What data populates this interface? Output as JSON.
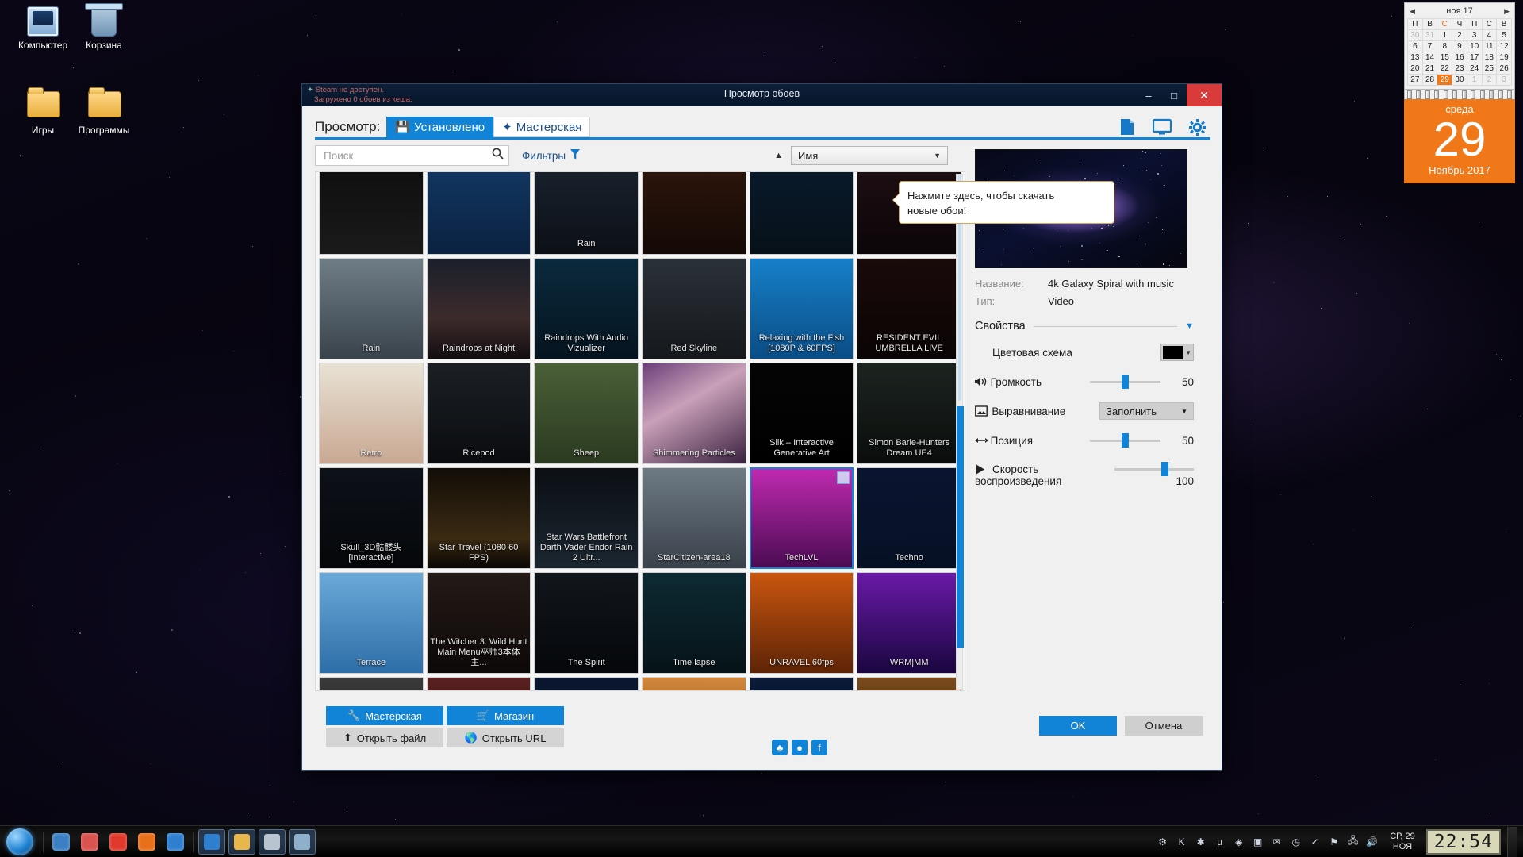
{
  "desktop": {
    "icons": [
      {
        "label": "Компьютер",
        "icon": "computer-icon"
      },
      {
        "label": "Корзина",
        "icon": "recycle-bin-icon"
      },
      {
        "label": "Игры",
        "icon": "folder-icon"
      },
      {
        "label": "Программы",
        "icon": "folder-icon"
      }
    ]
  },
  "calendar": {
    "month_label": "ноя 17",
    "prev_icon": "chevron-left-icon",
    "next_icon": "chevron-right-icon",
    "weekdays": [
      "П",
      "В",
      "С",
      "Ч",
      "П",
      "С",
      "В"
    ],
    "weeks": [
      [
        {
          "d": "30",
          "dim": true
        },
        {
          "d": "31",
          "dim": true
        },
        {
          "d": "1"
        },
        {
          "d": "2"
        },
        {
          "d": "3"
        },
        {
          "d": "4"
        },
        {
          "d": "5"
        }
      ],
      [
        {
          "d": "6"
        },
        {
          "d": "7"
        },
        {
          "d": "8"
        },
        {
          "d": "9"
        },
        {
          "d": "10"
        },
        {
          "d": "11"
        },
        {
          "d": "12"
        }
      ],
      [
        {
          "d": "13"
        },
        {
          "d": "14"
        },
        {
          "d": "15"
        },
        {
          "d": "16"
        },
        {
          "d": "17"
        },
        {
          "d": "18"
        },
        {
          "d": "19"
        }
      ],
      [
        {
          "d": "20"
        },
        {
          "d": "21"
        },
        {
          "d": "22"
        },
        {
          "d": "23"
        },
        {
          "d": "24"
        },
        {
          "d": "25"
        },
        {
          "d": "26"
        }
      ],
      [
        {
          "d": "27"
        },
        {
          "d": "28"
        },
        {
          "d": "29",
          "today": true
        },
        {
          "d": "30"
        },
        {
          "d": "1",
          "dim": true
        },
        {
          "d": "2",
          "dim": true
        },
        {
          "d": "3",
          "dim": true
        }
      ]
    ],
    "dow": "среда",
    "day": "29",
    "month_year": "Ноябрь 2017",
    "accent": "#f07818"
  },
  "window": {
    "title": "Просмотр обоев",
    "minimize_icon": "minimize-icon",
    "maximize_icon": "maximize-icon",
    "close_icon": "close-icon",
    "warnings": {
      "line1": "Steam не доступен.",
      "line2": "Загружено 0 обоев из кеша."
    },
    "header": {
      "view_label": "Просмотр:",
      "tabs": [
        {
          "label": "Установлено",
          "icon": "save-disk-icon",
          "active": true
        },
        {
          "label": "Мастерская",
          "icon": "steam-icon",
          "active": false
        }
      ],
      "icons": [
        {
          "name": "file-icon"
        },
        {
          "name": "monitor-icon"
        },
        {
          "name": "gear-icon"
        }
      ]
    },
    "tooltip": {
      "line1": "Нажмите здесь, чтобы скачать",
      "line2": "новые обои!"
    },
    "toolbar": {
      "search_placeholder": "Поиск",
      "search_value": "",
      "search_icon": "search-icon",
      "filters_label": "Фильтры",
      "filter_icon": "funnel-icon",
      "sort_direction_icon": "sort-ascending-icon",
      "sort_value": "Имя",
      "sort_caret_icon": "chevron-down-icon"
    },
    "grid": {
      "rows": [
        [
          {
            "caption": "",
            "cut": true,
            "bg": "linear-gradient(180deg,#0d0d0d,#1a1a1a)"
          },
          {
            "caption": "",
            "cut": true,
            "bg": "linear-gradient(180deg,#123a66,#0b2140)"
          },
          {
            "caption": "Rain",
            "cut": true,
            "bg": "linear-gradient(180deg,#1a2330,#0c1016)"
          },
          {
            "caption": "",
            "cut": true,
            "bg": "linear-gradient(180deg,#30170d,#140905)"
          },
          {
            "caption": "",
            "cut": true,
            "bg": "linear-gradient(180deg,#0a1b2e,#061018)"
          },
          {
            "caption": "",
            "cut": true,
            "bg": "linear-gradient(180deg,#201014,#0b0508)"
          }
        ],
        [
          {
            "caption": "Rain",
            "bg": "linear-gradient(180deg,#6f7d86,#39434c)"
          },
          {
            "caption": "Raindrops at Night",
            "bg": "linear-gradient(180deg,#1a1f2b,#3d2b2b 60%,#120d10)"
          },
          {
            "caption": "Raindrops With Audio Vizualizer",
            "bg": "linear-gradient(180deg,#0b2a3d,#05141f)"
          },
          {
            "caption": "Red Skyline",
            "bg": "linear-gradient(180deg,#2a3138,#15181c)"
          },
          {
            "caption": "Relaxing with the Fish [1080P & 60FPS]",
            "bg": "linear-gradient(180deg,#1680c8,#0a4d86)"
          },
          {
            "caption": "RESIDENT EVIL UMBRELLA LIVE",
            "bg": "linear-gradient(180deg,#1a0a0a,#0a0404)"
          }
        ],
        [
          {
            "caption": "Retro",
            "bg": "linear-gradient(180deg,#e8e2d4,#c9a893)"
          },
          {
            "caption": "Ricepod",
            "bg": "linear-gradient(180deg,#1b1f24,#0a0c0f)"
          },
          {
            "caption": "Sheep",
            "bg": "linear-gradient(180deg,#4a6038,#2b3a20)"
          },
          {
            "caption": "Shimmering Particles",
            "bg": "linear-gradient(150deg,#6b3f7a,#c9a0b8 40%,#3a2140)"
          },
          {
            "caption": "Silk – Interactive Generative Art",
            "bg": "linear-gradient(180deg,#050505,#000)"
          },
          {
            "caption": "Simon Barle-Hunters Dream UE4",
            "bg": "linear-gradient(180deg,#1c2420,#0a0d0b)"
          }
        ],
        [
          {
            "caption": "Skull_3D骷髅头[Interactive]",
            "bg": "linear-gradient(180deg,#0d1118,#05070a)"
          },
          {
            "caption": "Star Travel (1080 60 FPS)",
            "bg": "linear-gradient(180deg,#120d07,#3a2a12 70%,#0a0704)"
          },
          {
            "caption": "Star Wars Battlefront Darth Vader Endor Rain 2 Ultr...",
            "bg": "linear-gradient(180deg,#0b0f14,#1b2630)"
          },
          {
            "caption": "StarCitizen-area18",
            "bg": "linear-gradient(180deg,#6e7a84,#39414a)"
          },
          {
            "caption": "TechLVL",
            "selected": true,
            "bg": "linear-gradient(180deg,#c02ab0,#4a0b52)"
          },
          {
            "caption": "Techno",
            "bg": "linear-gradient(180deg,#0a1430,#061024)"
          }
        ],
        [
          {
            "caption": "Terrace",
            "bg": "linear-gradient(180deg,#6aa9d8,#2e6ea8)"
          },
          {
            "caption": "The Witcher 3: Wild Hunt Main Menu巫师3本体主...",
            "bg": "linear-gradient(180deg,#241a16,#0d0908)"
          },
          {
            "caption": "The Spirit",
            "bg": "linear-gradient(180deg,#11161c,#05070a)"
          },
          {
            "caption": "Time lapse",
            "bg": "linear-gradient(180deg,#0d2a33,#061318)"
          },
          {
            "caption": "UNRAVEL 60fps",
            "bg": "linear-gradient(180deg,#c9560f,#5e2406)"
          },
          {
            "caption": "WRM|MM",
            "bg": "linear-gradient(180deg,#6a1aa8,#1a0640)"
          }
        ],
        [
          {
            "caption": "",
            "cut": true,
            "bg": "linear-gradient(180deg,#3a3a3a,#101010)"
          },
          {
            "caption": "",
            "cut": true,
            "bg": "linear-gradient(180deg,#5a2020,#200808)"
          },
          {
            "caption": "",
            "cut": true,
            "bg": "linear-gradient(180deg,#0a1730,#04080f)"
          },
          {
            "caption": "",
            "cut": true,
            "bg": "linear-gradient(180deg,#d2883c,#6b3d14)"
          },
          {
            "caption": "",
            "cut": true,
            "bg": "linear-gradient(180deg,#0a1a38,#030812)"
          },
          {
            "caption": "",
            "cut": true,
            "bg": "linear-gradient(180deg,#7a4a1a,#2a1608)"
          }
        ]
      ]
    },
    "details": {
      "name_key": "Название:",
      "name_value": "4k Galaxy Spiral with music",
      "type_key": "Тип:",
      "type_value": "Video",
      "properties_label": "Свойства",
      "properties_caret_icon": "chevron-down-icon",
      "color_scheme_label": "Цветовая схема",
      "color_scheme_value": "#000000",
      "volume_label": "Громкость",
      "volume_icon": "speaker-icon",
      "volume_value": "50",
      "volume_percent": 50,
      "alignment_label": "Выравнивание",
      "alignment_icon": "image-icon",
      "alignment_value": "Заполнить",
      "position_label": "Позиция",
      "position_icon": "arrows-horizontal-icon",
      "position_value": "50",
      "position_percent": 50,
      "speed_label": "Скорость",
      "speed_label2": "воспроизведения",
      "speed_icon": "play-icon",
      "speed_value": "100",
      "speed_percent": 66
    },
    "footer": {
      "workshop_label": "Мастерская",
      "workshop_icon": "wrench-icon",
      "store_label": "Магазин",
      "store_icon": "cart-icon",
      "open_file_label": "Открыть файл",
      "open_file_icon": "upload-icon",
      "open_url_label": "Открыть URL",
      "open_url_icon": "globe-icon",
      "social": [
        {
          "name": "steam-icon",
          "glyph": "♨"
        },
        {
          "name": "twitter-icon",
          "glyph": "🐦"
        },
        {
          "name": "facebook-icon",
          "glyph": "f"
        }
      ],
      "ok_label": "OK",
      "cancel_label": "Отмена"
    }
  },
  "taskbar": {
    "start_icon": "windows-start-icon",
    "pinned": [
      {
        "name": "explorer-taskbar-icon",
        "glyph": "🗂"
      },
      {
        "name": "chrome-taskbar-icon",
        "glyph": "◉"
      },
      {
        "name": "opera-taskbar-icon",
        "glyph": "O"
      },
      {
        "name": "firefox-taskbar-icon",
        "glyph": "🦊"
      },
      {
        "name": "edge-taskbar-icon",
        "glyph": "e"
      }
    ],
    "running": [
      {
        "name": "wallpaper-engine-taskbar-icon",
        "glyph": "▣"
      },
      {
        "name": "folder-taskbar-icon",
        "glyph": "📁"
      },
      {
        "name": "app-taskbar-icon",
        "glyph": "▤"
      },
      {
        "name": "app2-taskbar-icon",
        "glyph": "▥"
      }
    ],
    "tray": [
      {
        "name": "tray-settings-icon",
        "glyph": "⚙"
      },
      {
        "name": "tray-kaspersky-icon",
        "glyph": "K"
      },
      {
        "name": "tray-bluetooth-icon",
        "glyph": "✱"
      },
      {
        "name": "tray-utorrent-icon",
        "glyph": "µ"
      },
      {
        "name": "tray-shield-icon",
        "glyph": "◈"
      },
      {
        "name": "tray-media-icon",
        "glyph": "▣"
      },
      {
        "name": "tray-mail-icon",
        "glyph": "✉"
      },
      {
        "name": "tray-clock-app-icon",
        "glyph": "◷"
      },
      {
        "name": "tray-usb-icon",
        "glyph": "✓"
      },
      {
        "name": "tray-flag-icon",
        "glyph": "⚑"
      },
      {
        "name": "tray-network-icon",
        "glyph": "🖧"
      },
      {
        "name": "tray-volume-icon",
        "glyph": "🔊"
      }
    ],
    "date_line1": "СР, 29",
    "date_line2": "НОЯ",
    "clock": "22:54"
  }
}
